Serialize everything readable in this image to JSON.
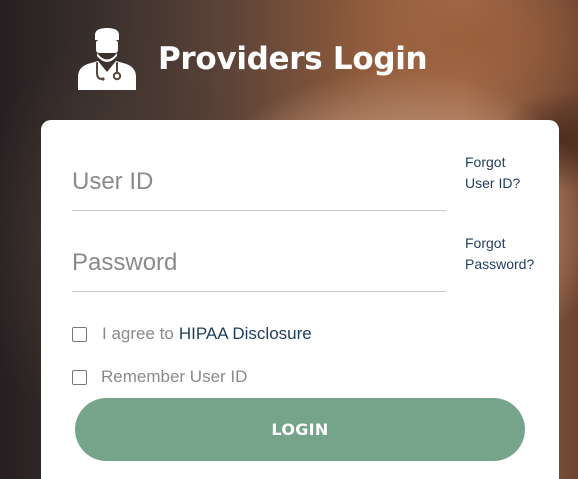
{
  "header": {
    "icon": "doctor-icon",
    "title": "Providers Login"
  },
  "form": {
    "userid_placeholder": "User ID",
    "userid_value": "",
    "password_placeholder": "Password",
    "password_value": "",
    "forgot_userid_line1": "Forgot",
    "forgot_userid_line2": "User ID?",
    "forgot_password_line1": "Forgot",
    "forgot_password_line2": "Password?",
    "agree_text": "I agree to",
    "hipaa_link": "HIPAA Disclosure",
    "agree_checked": false,
    "remember_text": "Remember User ID",
    "remember_checked": false,
    "login_label": "LOGIN"
  },
  "colors": {
    "button": "#76a48a",
    "link": "#1f3d5c",
    "placeholder": "#8a8a8a"
  }
}
